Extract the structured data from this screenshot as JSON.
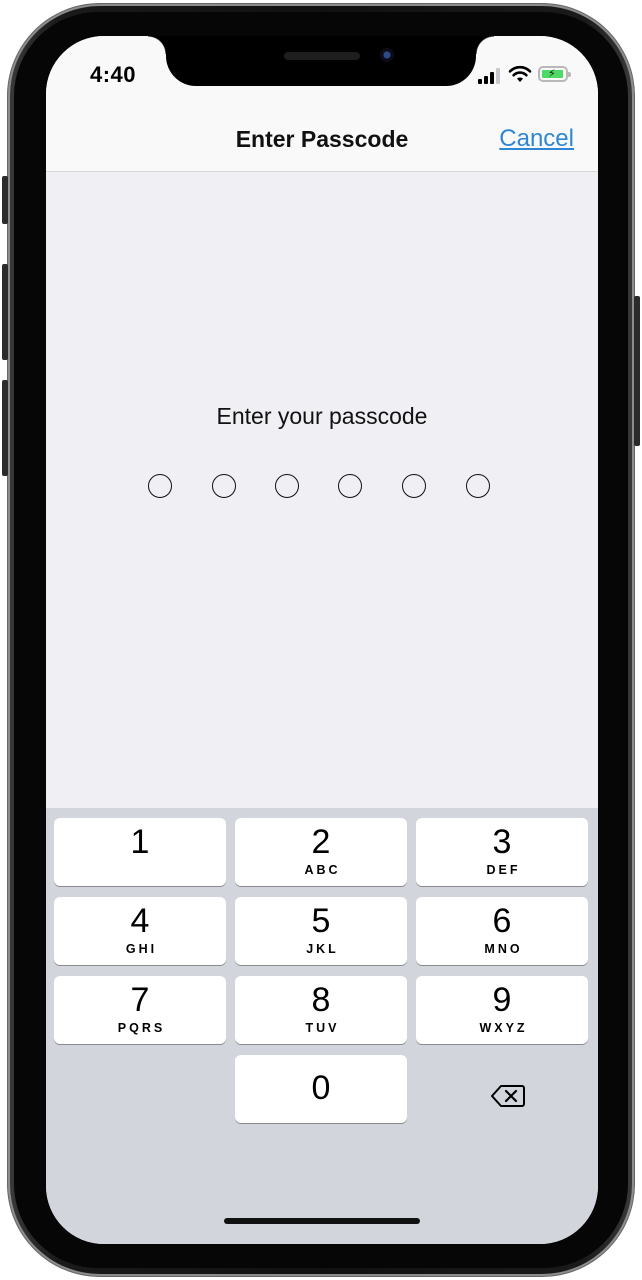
{
  "status_bar": {
    "time": "4:40",
    "signal_icon": "cellular-signal-icon",
    "wifi_icon": "wifi-icon",
    "battery_icon": "battery-charging-icon"
  },
  "nav": {
    "title": "Enter Passcode",
    "cancel_label": "Cancel",
    "cancel_color": "#2f86d4"
  },
  "passcode": {
    "prompt": "Enter your passcode",
    "digit_count": 6,
    "entered_count": 0
  },
  "keypad": {
    "keys": [
      {
        "num": "1",
        "letters": ""
      },
      {
        "num": "2",
        "letters": "ABC"
      },
      {
        "num": "3",
        "letters": "DEF"
      },
      {
        "num": "4",
        "letters": "GHI"
      },
      {
        "num": "5",
        "letters": "JKL"
      },
      {
        "num": "6",
        "letters": "MNO"
      },
      {
        "num": "7",
        "letters": "PQRS"
      },
      {
        "num": "8",
        "letters": "TUV"
      },
      {
        "num": "9",
        "letters": "WXYZ"
      },
      {
        "num": "0",
        "letters": ""
      }
    ],
    "delete_icon": "backspace-icon"
  }
}
